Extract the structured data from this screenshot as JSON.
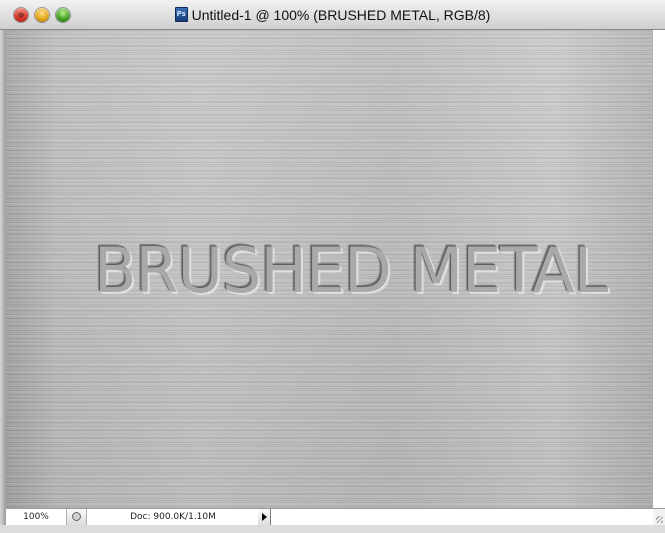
{
  "window": {
    "title": "Untitled-1 @ 100% (BRUSHED METAL, RGB/8)",
    "app_icon": "photoshop-document-icon",
    "traffic_lights": [
      {
        "name": "close",
        "color": "#d0281c"
      },
      {
        "name": "minimize",
        "color": "#e0a010"
      },
      {
        "name": "zoom",
        "color": "#3a9a1a"
      }
    ]
  },
  "canvas": {
    "text": "BRUSHED METAL",
    "metal_color": "#bdbdbd"
  },
  "statusbar": {
    "zoom": "100%",
    "doc_info": "Doc: 900.0K/1.10M",
    "menu_icon": "triangle-right-icon",
    "preview_icon": "preview-icon"
  }
}
